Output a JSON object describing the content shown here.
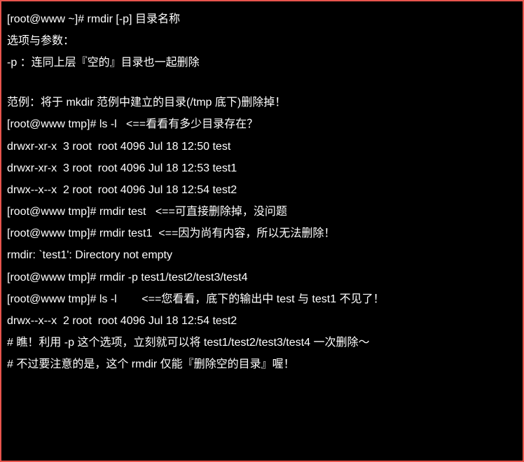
{
  "lines": [
    "[root@www ~]# rmdir [-p] 目录名称",
    "选项与参数：",
    "-p ：连同上层『空的』目录也一起删除",
    "",
    "范例：将于 mkdir 范例中建立的目录(/tmp 底下)删除掉！",
    "[root@www tmp]# ls -l   <==看看有多少目录存在？",
    "drwxr-xr-x  3 root  root 4096 Jul 18 12:50 test",
    "drwxr-xr-x  3 root  root 4096 Jul 18 12:53 test1",
    "drwx--x--x  2 root  root 4096 Jul 18 12:54 test2",
    "[root@www tmp]# rmdir test   <==可直接删除掉，没问题",
    "[root@www tmp]# rmdir test1  <==因为尚有内容，所以无法删除！",
    "rmdir: `test1': Directory not empty",
    "[root@www tmp]# rmdir -p test1/test2/test3/test4",
    "[root@www tmp]# ls -l        <==您看看，底下的输出中 test 与 test1 不见了！",
    "drwx--x--x  2 root  root 4096 Jul 18 12:54 test2",
    "# 瞧！利用 -p 这个选项，立刻就可以将 test1/test2/test3/test4 一次删除～",
    "# 不过要注意的是，这个 rmdir 仅能『删除空的目录』喔！"
  ]
}
